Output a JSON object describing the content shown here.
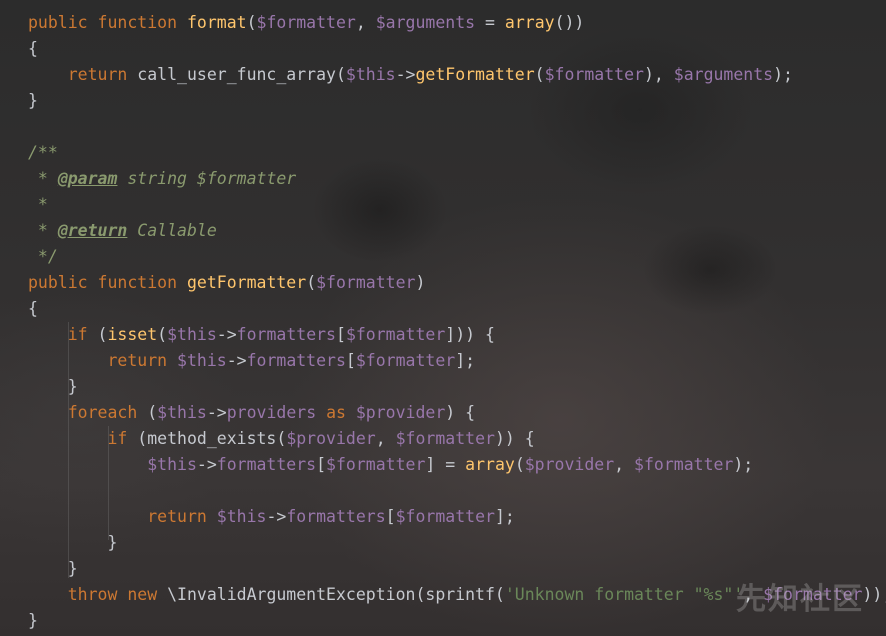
{
  "editor": {
    "lines": [
      [
        {
          "t": "public",
          "c": "kw"
        },
        {
          "t": " ",
          "c": "tx"
        },
        {
          "t": "function",
          "c": "kw"
        },
        {
          "t": " ",
          "c": "tx"
        },
        {
          "t": "format",
          "c": "fn"
        },
        {
          "t": "(",
          "c": "tx"
        },
        {
          "t": "$formatter",
          "c": "var"
        },
        {
          "t": ", ",
          "c": "tx"
        },
        {
          "t": "$arguments",
          "c": "var"
        },
        {
          "t": " = ",
          "c": "tx"
        },
        {
          "t": "array",
          "c": "fn"
        },
        {
          "t": "())",
          "c": "tx"
        }
      ],
      [
        {
          "t": "{",
          "c": "tx"
        }
      ],
      [
        {
          "t": "    ",
          "c": "tx"
        },
        {
          "t": "return",
          "c": "kw"
        },
        {
          "t": " call_user_func_array(",
          "c": "tx"
        },
        {
          "t": "$this",
          "c": "var"
        },
        {
          "t": "->",
          "c": "tx"
        },
        {
          "t": "getFormatter",
          "c": "fn"
        },
        {
          "t": "(",
          "c": "tx"
        },
        {
          "t": "$formatter",
          "c": "var"
        },
        {
          "t": "), ",
          "c": "tx"
        },
        {
          "t": "$arguments",
          "c": "var"
        },
        {
          "t": ");",
          "c": "tx"
        }
      ],
      [
        {
          "t": "}",
          "c": "tx"
        }
      ],
      [
        {
          "t": "",
          "c": "tx"
        }
      ],
      [
        {
          "t": "/**",
          "c": "cmt"
        }
      ],
      [
        {
          "t": " * ",
          "c": "cmt"
        },
        {
          "t": "@param",
          "c": "tag"
        },
        {
          "t": " string ",
          "c": "cmt"
        },
        {
          "t": "$formatter",
          "c": "cmt"
        }
      ],
      [
        {
          "t": " *",
          "c": "cmt"
        }
      ],
      [
        {
          "t": " * ",
          "c": "cmt"
        },
        {
          "t": "@return",
          "c": "tag"
        },
        {
          "t": " Callable",
          "c": "cmt"
        }
      ],
      [
        {
          "t": " */",
          "c": "cmt"
        }
      ],
      [
        {
          "t": "public",
          "c": "kw"
        },
        {
          "t": " ",
          "c": "tx"
        },
        {
          "t": "function",
          "c": "kw"
        },
        {
          "t": " ",
          "c": "tx"
        },
        {
          "t": "getFormatter",
          "c": "fn"
        },
        {
          "t": "(",
          "c": "tx"
        },
        {
          "t": "$formatter",
          "c": "var"
        },
        {
          "t": ")",
          "c": "tx"
        }
      ],
      [
        {
          "t": "{",
          "c": "tx"
        }
      ],
      [
        {
          "t": "    ",
          "c": "tx"
        },
        {
          "t": "if",
          "c": "kw"
        },
        {
          "t": " (",
          "c": "tx"
        },
        {
          "t": "isset",
          "c": "fn"
        },
        {
          "t": "(",
          "c": "tx"
        },
        {
          "t": "$this",
          "c": "var"
        },
        {
          "t": "->",
          "c": "tx"
        },
        {
          "t": "formatters",
          "c": "var"
        },
        {
          "t": "[",
          "c": "tx"
        },
        {
          "t": "$formatter",
          "c": "var"
        },
        {
          "t": "])) {",
          "c": "tx"
        }
      ],
      [
        {
          "t": "        ",
          "c": "tx"
        },
        {
          "t": "return",
          "c": "kw"
        },
        {
          "t": " ",
          "c": "tx"
        },
        {
          "t": "$this",
          "c": "var"
        },
        {
          "t": "->",
          "c": "tx"
        },
        {
          "t": "formatters",
          "c": "var"
        },
        {
          "t": "[",
          "c": "tx"
        },
        {
          "t": "$formatter",
          "c": "var"
        },
        {
          "t": "];",
          "c": "tx"
        }
      ],
      [
        {
          "t": "    }",
          "c": "tx"
        }
      ],
      [
        {
          "t": "    ",
          "c": "tx"
        },
        {
          "t": "foreach",
          "c": "kw"
        },
        {
          "t": " (",
          "c": "tx"
        },
        {
          "t": "$this",
          "c": "var"
        },
        {
          "t": "->",
          "c": "tx"
        },
        {
          "t": "providers",
          "c": "var"
        },
        {
          "t": " ",
          "c": "tx"
        },
        {
          "t": "as",
          "c": "kw"
        },
        {
          "t": " ",
          "c": "tx"
        },
        {
          "t": "$provider",
          "c": "var"
        },
        {
          "t": ") {",
          "c": "tx"
        }
      ],
      [
        {
          "t": "        ",
          "c": "tx"
        },
        {
          "t": "if",
          "c": "kw"
        },
        {
          "t": " (method_exists(",
          "c": "tx"
        },
        {
          "t": "$provider",
          "c": "var"
        },
        {
          "t": ", ",
          "c": "tx"
        },
        {
          "t": "$formatter",
          "c": "var"
        },
        {
          "t": ")) {",
          "c": "tx"
        }
      ],
      [
        {
          "t": "            ",
          "c": "tx"
        },
        {
          "t": "$this",
          "c": "var"
        },
        {
          "t": "->",
          "c": "tx"
        },
        {
          "t": "formatters",
          "c": "var"
        },
        {
          "t": "[",
          "c": "tx"
        },
        {
          "t": "$formatter",
          "c": "var"
        },
        {
          "t": "] = ",
          "c": "tx"
        },
        {
          "t": "array",
          "c": "fn"
        },
        {
          "t": "(",
          "c": "tx"
        },
        {
          "t": "$provider",
          "c": "var"
        },
        {
          "t": ", ",
          "c": "tx"
        },
        {
          "t": "$formatter",
          "c": "var"
        },
        {
          "t": ");",
          "c": "tx"
        }
      ],
      [
        {
          "t": "",
          "c": "tx"
        }
      ],
      [
        {
          "t": "            ",
          "c": "tx"
        },
        {
          "t": "return",
          "c": "kw"
        },
        {
          "t": " ",
          "c": "tx"
        },
        {
          "t": "$this",
          "c": "var"
        },
        {
          "t": "->",
          "c": "tx"
        },
        {
          "t": "formatters",
          "c": "var"
        },
        {
          "t": "[",
          "c": "tx"
        },
        {
          "t": "$formatter",
          "c": "var"
        },
        {
          "t": "];",
          "c": "tx"
        }
      ],
      [
        {
          "t": "        }",
          "c": "tx"
        }
      ],
      [
        {
          "t": "    }",
          "c": "tx"
        }
      ],
      [
        {
          "t": "    ",
          "c": "tx"
        },
        {
          "t": "throw",
          "c": "kw"
        },
        {
          "t": " ",
          "c": "tx"
        },
        {
          "t": "new",
          "c": "kw"
        },
        {
          "t": " \\InvalidArgumentException(sprintf(",
          "c": "tx"
        },
        {
          "t": "'Unknown formatter \"%s\"'",
          "c": "str"
        },
        {
          "t": ", ",
          "c": "tx"
        },
        {
          "t": "$formatter",
          "c": "var"
        },
        {
          "t": "));",
          "c": "tx"
        }
      ],
      [
        {
          "t": "}",
          "c": "tx"
        }
      ]
    ],
    "highlight_line": 22
  },
  "watermark": {
    "text": "先知社区"
  }
}
